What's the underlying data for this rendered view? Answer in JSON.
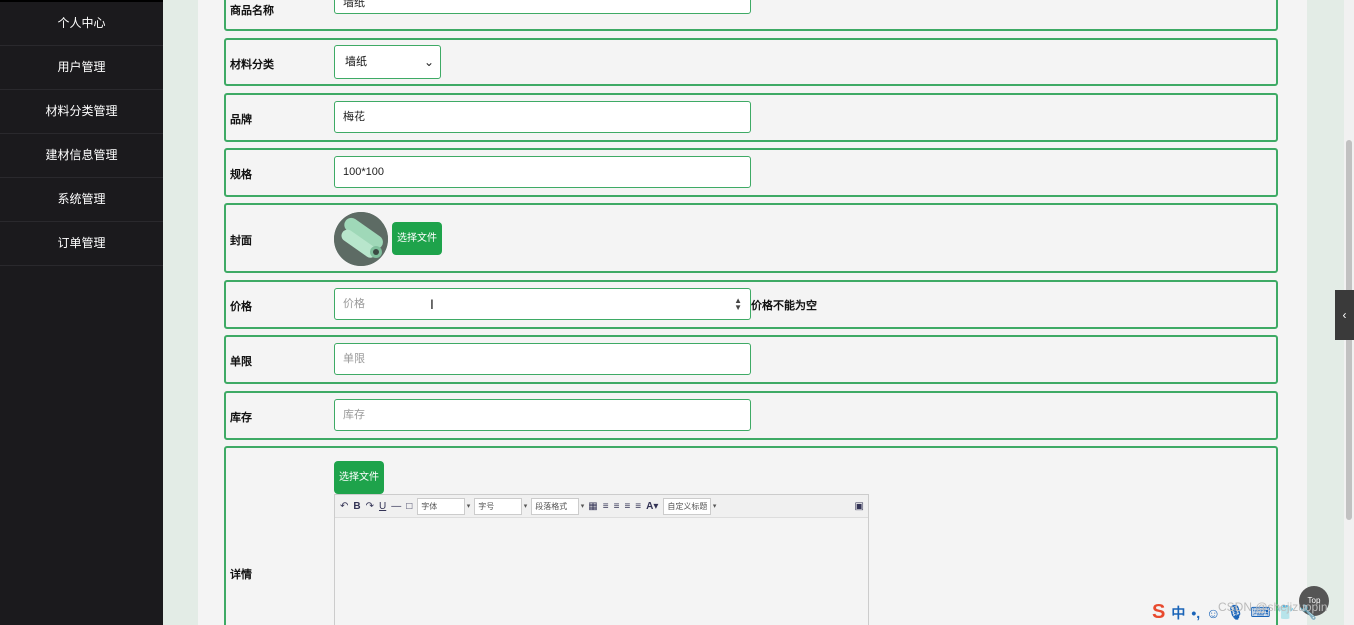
{
  "sidebar": {
    "items": [
      "个人中心",
      "用户管理",
      "材料分类管理",
      "建材信息管理",
      "系统管理",
      "订单管理"
    ]
  },
  "form": {
    "product_name": {
      "label": "商品名称",
      "value": "墙纸"
    },
    "category": {
      "label": "材料分类",
      "value": "墙纸"
    },
    "brand": {
      "label": "品牌",
      "value": "梅花"
    },
    "spec": {
      "label": "规格",
      "value": "100*100"
    },
    "cover": {
      "label": "封面",
      "button": "选择文件"
    },
    "price": {
      "label": "价格",
      "placeholder": "价格",
      "error": "价格不能为空"
    },
    "limit": {
      "label": "单限",
      "placeholder": "单限"
    },
    "stock": {
      "label": "库存",
      "placeholder": "库存"
    },
    "detail": {
      "label": "详情",
      "button": "选择文件",
      "toolbar": {
        "font": "字体",
        "size": "字号",
        "paragraph": "段落格式",
        "custom_title": "自定义标题"
      }
    }
  },
  "misc": {
    "top_button": "Top",
    "watermark": "CSDN @shejizuopin"
  },
  "colors": {
    "sidebar_bg": "#1b1a1d",
    "accent_green": "#1ea34b",
    "border_green": "#3eaa65"
  }
}
